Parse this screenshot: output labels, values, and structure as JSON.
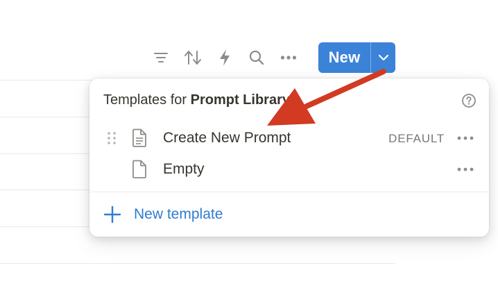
{
  "toolbar": {
    "icons": [
      "filter-icon",
      "sort-icon",
      "lightning-icon",
      "search-icon",
      "more-icon"
    ],
    "new_button_label": "New",
    "new_button_color": "#3b82d9"
  },
  "templates_panel": {
    "title_prefix": "Templates for ",
    "title_db": "Prompt Library",
    "items": [
      {
        "label": "Create New Prompt",
        "badge": "DEFAULT",
        "icon": "document-lines-icon"
      },
      {
        "label": "Empty",
        "badge": "",
        "icon": "document-blank-icon"
      }
    ],
    "new_template_label": "New template",
    "link_color": "#2f7bd1"
  },
  "annotation": {
    "arrow_color": "#d23a22"
  }
}
